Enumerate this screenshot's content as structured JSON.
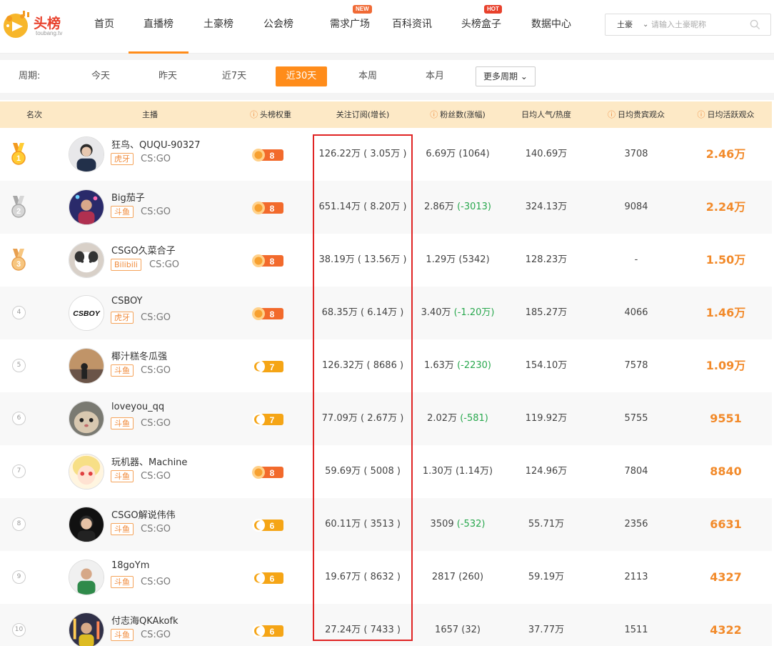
{
  "header": {
    "logo_text": "头榜",
    "logo_sub": "toubang.tv",
    "nav": [
      {
        "label": "首页",
        "badge": ""
      },
      {
        "label": "直播榜",
        "badge": "",
        "active": true
      },
      {
        "label": "土豪榜",
        "badge": ""
      },
      {
        "label": "公会榜",
        "badge": ""
      },
      {
        "label": "需求广场",
        "badge": "NEW"
      },
      {
        "label": "百科资讯",
        "badge": ""
      },
      {
        "label": "头榜盒子",
        "badge": "HOT"
      },
      {
        "label": "数据中心",
        "badge": ""
      }
    ],
    "search": {
      "type": "土豪",
      "placeholder": "请输入土豪昵称"
    }
  },
  "period": {
    "label": "周期:",
    "options": [
      "今天",
      "昨天",
      "近7天",
      "近30天",
      "本周",
      "本月"
    ],
    "active": "近30天",
    "more": "更多周期"
  },
  "table": {
    "columns": [
      "名次",
      "主播",
      "头榜权重",
      "关注订阅(增长)",
      "粉丝数(涨幅)",
      "日均人气/热度",
      "日均贵宾观众",
      "日均活跃观众"
    ],
    "rows": [
      {
        "rank": "1",
        "name": "狂鸟、QUQU-90327",
        "platform": "虎牙",
        "game": "CS:GO",
        "weight": "8",
        "follow": "126.22万 ( 3.05万 )",
        "fans": "6.69万 (1064)",
        "fans_delta_negative": false,
        "popularity": "140.69万",
        "vip": "3708",
        "active": "2.46万"
      },
      {
        "rank": "2",
        "name": "Big茄子",
        "platform": "斗鱼",
        "game": "CS:GO",
        "weight": "8",
        "follow": "651.14万 ( 8.20万 )",
        "fans": "2.86万",
        "fans_delta": "(-3013)",
        "fans_delta_negative": true,
        "popularity": "324.13万",
        "vip": "9084",
        "active": "2.24万"
      },
      {
        "rank": "3",
        "name": "CSGO久菜合子",
        "platform": "Bilibili",
        "game": "CS:GO",
        "weight": "8",
        "follow": "38.19万 ( 13.56万 )",
        "fans": "1.29万 (5342)",
        "fans_delta_negative": false,
        "popularity": "128.23万",
        "vip": "-",
        "active": "1.50万"
      },
      {
        "rank": "4",
        "name": "CSBOY",
        "platform": "虎牙",
        "game": "CS:GO",
        "weight": "8",
        "follow": "68.35万 ( 6.14万 )",
        "fans": "3.40万",
        "fans_delta": "(-1.20万)",
        "fans_delta_negative": true,
        "popularity": "185.27万",
        "vip": "4066",
        "active": "1.46万"
      },
      {
        "rank": "5",
        "name": "椰汁糕冬瓜强",
        "platform": "斗鱼",
        "game": "CS:GO",
        "weight": "7",
        "follow": "126.32万 ( 8686 )",
        "fans": "1.63万",
        "fans_delta": "(-2230)",
        "fans_delta_negative": true,
        "popularity": "154.10万",
        "vip": "7578",
        "active": "1.09万"
      },
      {
        "rank": "6",
        "name": "loveyou_qq",
        "platform": "斗鱼",
        "game": "CS:GO",
        "weight": "7",
        "follow": "77.09万 ( 2.67万 )",
        "fans": "2.02万",
        "fans_delta": "(-581)",
        "fans_delta_negative": true,
        "popularity": "119.92万",
        "vip": "5755",
        "active": "9551"
      },
      {
        "rank": "7",
        "name": "玩机器、Machine",
        "platform": "斗鱼",
        "game": "CS:GO",
        "weight": "8",
        "follow": "59.69万 ( 5008 )",
        "fans": "1.30万 (1.14万)",
        "fans_delta_negative": false,
        "popularity": "124.96万",
        "vip": "7804",
        "active": "8840"
      },
      {
        "rank": "8",
        "name": "CSGO解说伟伟",
        "platform": "斗鱼",
        "game": "CS:GO",
        "weight": "6",
        "follow": "60.11万 ( 3513 )",
        "fans": "3509",
        "fans_delta": "(-532)",
        "fans_delta_negative": true,
        "popularity": "55.71万",
        "vip": "2356",
        "active": "6631"
      },
      {
        "rank": "9",
        "name": "18goYm",
        "platform": "斗鱼",
        "game": "CS:GO",
        "weight": "6",
        "follow": "19.67万 ( 8632 )",
        "fans": "2817 (260)",
        "fans_delta_negative": false,
        "popularity": "59.19万",
        "vip": "2113",
        "active": "4327"
      },
      {
        "rank": "10",
        "name": "付志海QKAkofk",
        "platform": "斗鱼",
        "game": "CS:GO",
        "weight": "6",
        "follow": "27.24万 ( 7433 )",
        "fans": "1657 (32)",
        "fans_delta_negative": false,
        "popularity": "37.77万",
        "vip": "1511",
        "active": "4322"
      }
    ]
  },
  "colors": {
    "accent": "#ff8c1a",
    "header_bg": "#fde9c6",
    "negative": "#29a84e",
    "highlight_box": "#e02424"
  }
}
